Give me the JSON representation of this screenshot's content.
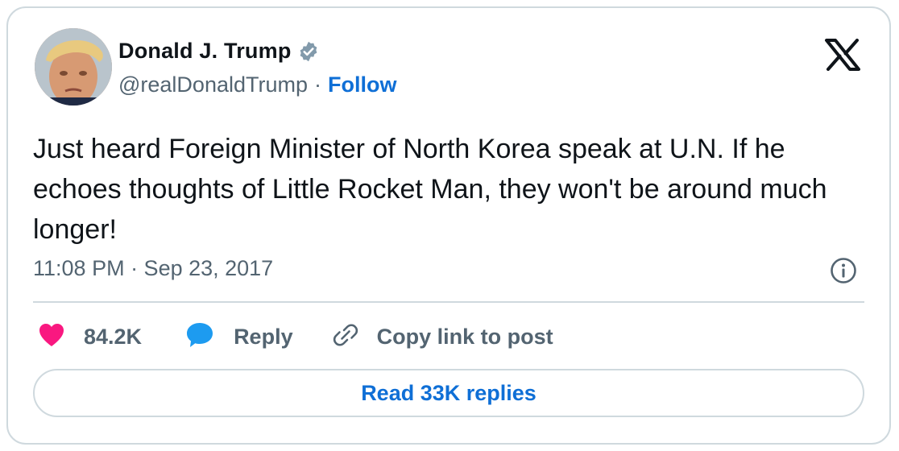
{
  "author": {
    "name": "Donald J. Trump",
    "handle": "@realDonaldTrump",
    "separator": "·",
    "follow_label": "Follow"
  },
  "tweet": {
    "text": "Just heard Foreign Minister of North Korea speak at U.N. If he echoes thoughts of Little Rocket Man, they won't be around much longer!",
    "timestamp": "11:08 PM · Sep 23, 2017"
  },
  "actions": {
    "likes": "84.2K",
    "reply_label": "Reply",
    "copy_link_label": "Copy link to post"
  },
  "read_replies_label": "Read 33K replies",
  "icons": {
    "verified": "verified-badge-icon",
    "x_logo": "x-logo-icon",
    "info": "info-icon",
    "like": "heart-icon",
    "reply": "chat-bubble-icon",
    "copy": "link-icon"
  },
  "colors": {
    "text": "#0f1419",
    "secondary": "#536471",
    "link": "#0f6fd6",
    "heart": "#f91880",
    "reply_bubble": "#1d9bf0",
    "border": "#cfd9de",
    "verified": "#829aab"
  }
}
